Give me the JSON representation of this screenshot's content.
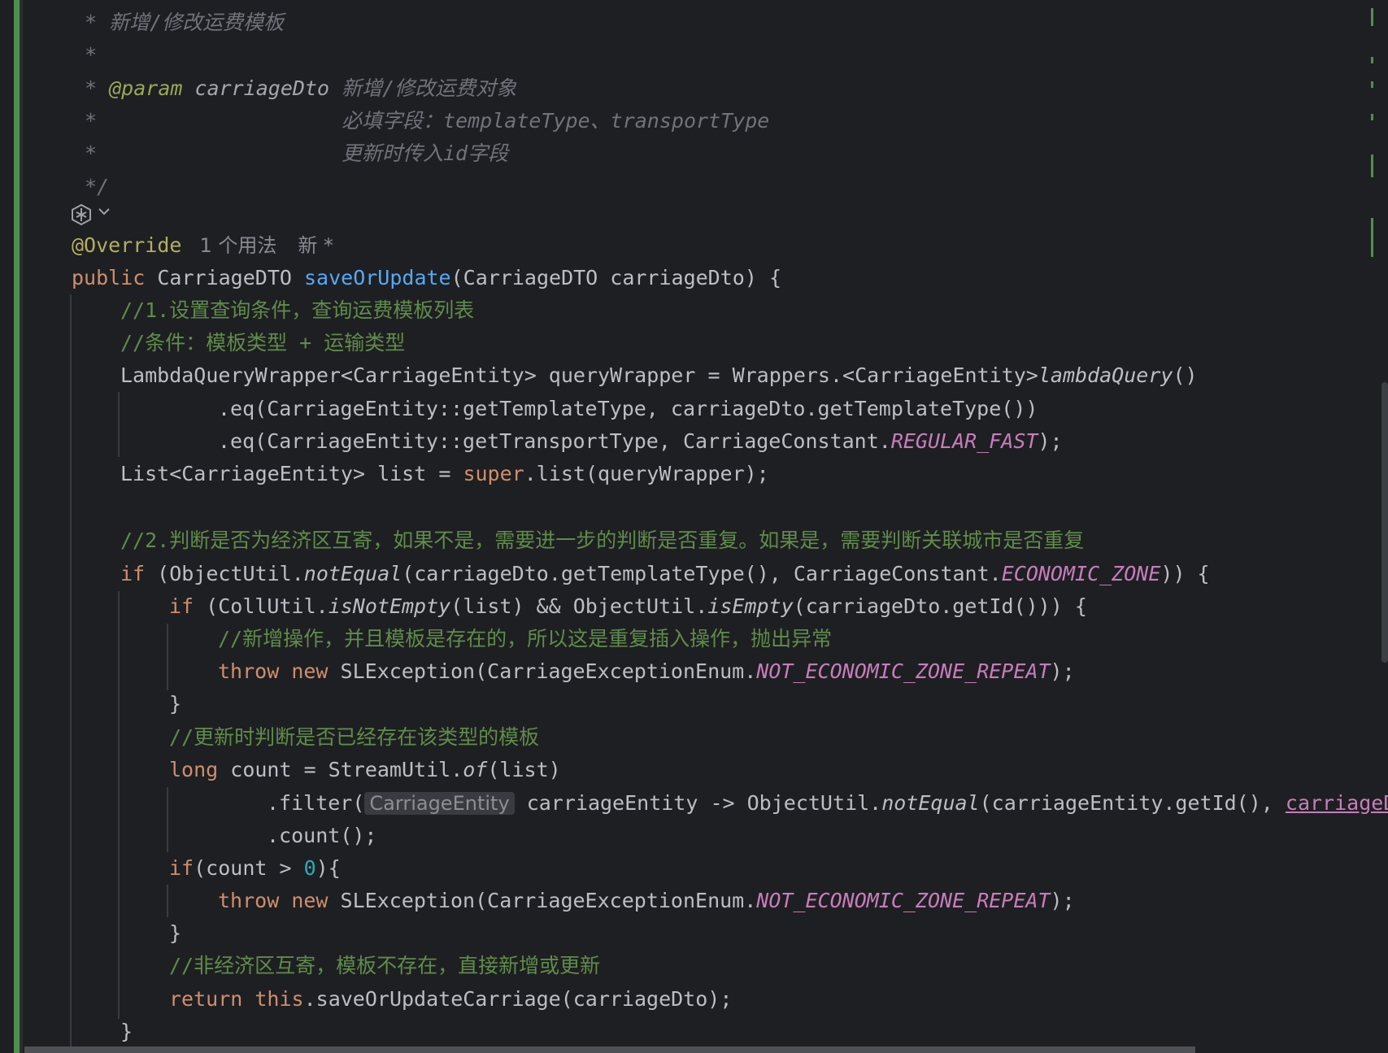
{
  "comment": {
    "title": "* 新增/修改运费模板",
    "star": "*",
    "param_prefix": "* ",
    "param_tag": "@param",
    "param_name": " carriageDto ",
    "param_desc": "新增/修改运费对象",
    "req_label": "必填字段：",
    "req_fields": "templateType、transportType",
    "update_note": "更新时传入id字段",
    "close": "*/"
  },
  "hints": {
    "usages": "1 个用法",
    "status": "新 *"
  },
  "method": {
    "annotation": "@Override",
    "kw_public": "public",
    "type": " CarriageDTO ",
    "name": "saveOrUpdate",
    "params": "(CarriageDTO carriageDto) {"
  },
  "code": {
    "c1": "//1.设置查询条件，查询运费模板列表",
    "c2": "//条件：模板类型 + 运输类型",
    "l3a": "LambdaQueryWrapper<CarriageEntity> queryWrapper = Wrappers.<CarriageEntity>",
    "l3b": "lambdaQuery",
    "l3c": "()",
    "l4": ".eq(CarriageEntity::getTemplateType, carriageDto.getTemplateType())",
    "l5a": ".eq(CarriageEntity::getTransportType, CarriageConstant.",
    "l5b": "REGULAR_FAST",
    "l5c": ");",
    "l6a": "List<CarriageEntity> list = ",
    "l6b": "super",
    "l6c": ".list(queryWrapper);",
    "c7": "//2.判断是否为经济区互寄，如果不是，需要进一步的判断是否重复。如果是，需要判断关联城市是否重复",
    "l8kw": "if",
    "l8a": " (ObjectUtil.",
    "l8b": "notEqual",
    "l8c": "(carriageDto.getTemplateType(), CarriageConstant.",
    "l8d": "ECONOMIC_ZONE",
    "l8e": ")) {",
    "l9kw": "if",
    "l9a": " (CollUtil.",
    "l9b": "isNotEmpty",
    "l9c": "(list) && ObjectUtil.",
    "l9d": "isEmpty",
    "l9e": "(carriageDto.getId())) {",
    "c10": "//新增操作，并且模板是存在的，所以这是重复插入操作，抛出异常",
    "kw_throw": "throw",
    "kw_new": "new",
    "l11a": " SLException(CarriageExceptionEnum.",
    "l11b": "NOT_ECONOMIC_ZONE_REPEAT",
    "l11c": ");",
    "brace_close": "}",
    "c13": "//更新时判断是否已经存在该类型的模板",
    "kw_long": "long",
    "l14a": " count = StreamUtil.",
    "l14b": "of",
    "l14c": "(list)",
    "l15a": ".filter(",
    "l15hint": "CarriageEntity",
    "l15b": " carriageEntity -> ObjectUtil.",
    "l15c": "notEqual",
    "l15d": "(carriageEntity.getId(), ",
    "l15e": "carriageDto",
    "l16": ".count();",
    "l17kw": "if",
    "l17a": "(count > ",
    "l17num": "0",
    "l17b": "){",
    "c20": "//非经济区互寄，模板不存在，直接新增或更新",
    "kw_return": "return",
    "kw_this": "this",
    "l21a": ".saveOrUpdateCarriage(carriageDto);"
  },
  "colors": {
    "background": "#1e1f22",
    "text": "#bcbec4",
    "keyword": "#cf8e6d",
    "method_decl": "#56a8f5",
    "annotation": "#b3ae60",
    "static_field": "#c77dbb",
    "doc_comment": "#6f737a",
    "line_comment": "#5f8c4a",
    "number": "#2aacb8",
    "vcs_modified": "#4f8f4e"
  },
  "icons": [
    "ai-assistant-icon",
    "chevron-down-icon"
  ]
}
